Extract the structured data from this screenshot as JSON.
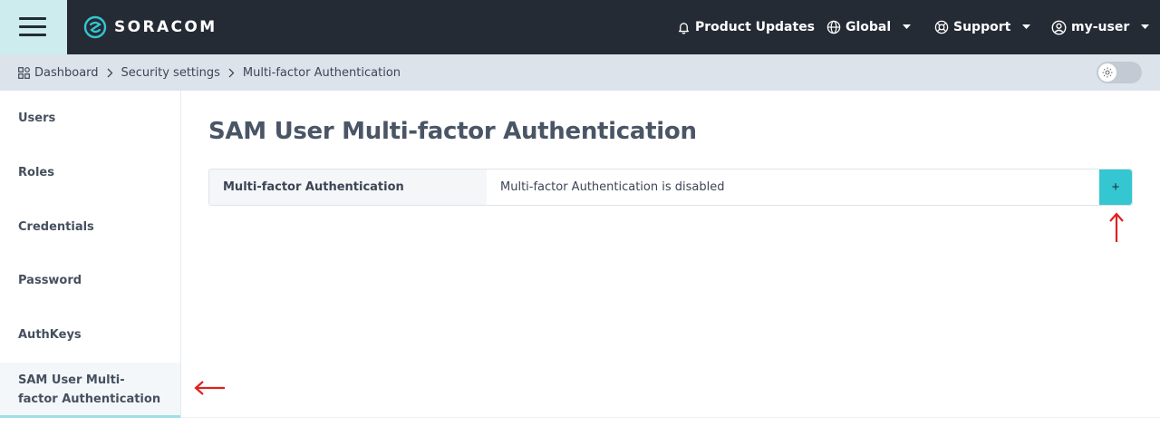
{
  "header": {
    "brand": "SORACOM",
    "product_updates": "Product Updates",
    "region": "Global",
    "support": "Support",
    "user": "my-user"
  },
  "breadcrumb": {
    "items": [
      "Dashboard",
      "Security settings",
      "Multi-factor Authentication"
    ]
  },
  "sidebar": {
    "items": [
      {
        "label": "Users"
      },
      {
        "label": "Roles"
      },
      {
        "label": "Credentials"
      },
      {
        "label": "Password"
      },
      {
        "label": "AuthKeys"
      },
      {
        "label": "SAM User Multi-factor Authentication",
        "active": true
      }
    ]
  },
  "main": {
    "title": "SAM User Multi-factor Authentication",
    "mfa_label": "Multi-factor Authentication",
    "mfa_status": "Multi-factor Authentication is disabled",
    "add_label": "+"
  },
  "colors": {
    "topbar": "#252b35",
    "accent": "#34c6d1",
    "annotation": "#e02020"
  }
}
